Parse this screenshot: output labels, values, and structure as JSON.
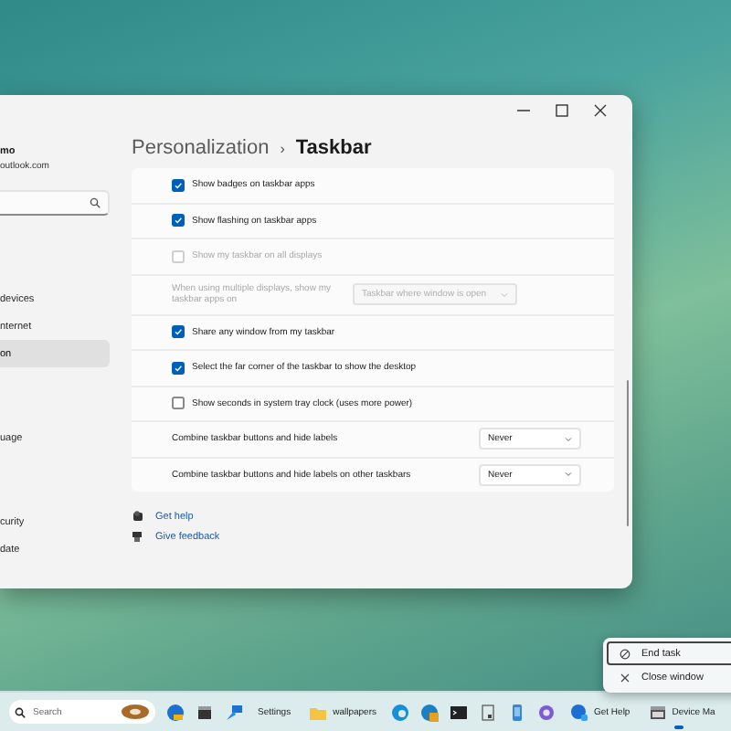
{
  "window": {
    "user": {
      "name": "mo",
      "email": "outlook.com"
    },
    "sidebar": {
      "items": [
        {
          "label": "devices",
          "selected": false
        },
        {
          "label": "nternet",
          "selected": false
        },
        {
          "label": "on",
          "selected": true
        },
        {
          "label": "uage",
          "selected": false
        },
        {
          "label": "curity",
          "selected": false
        },
        {
          "label": "date",
          "selected": false
        }
      ]
    },
    "breadcrumb": {
      "parent": "Personalization",
      "separator": "›",
      "current": "Taskbar"
    },
    "settings": [
      {
        "kind": "checkbox",
        "label": "Show badges on taskbar apps",
        "checked": true,
        "disabled": false
      },
      {
        "kind": "checkbox",
        "label": "Show flashing on taskbar apps",
        "checked": true,
        "disabled": false
      },
      {
        "kind": "checkbox",
        "label": "Show my taskbar on all displays",
        "checked": false,
        "disabled": true
      },
      {
        "kind": "select",
        "label": "When using multiple displays, show my taskbar apps on",
        "value": "Taskbar where window is open",
        "disabled": true
      },
      {
        "kind": "checkbox",
        "label": "Share any window from my taskbar",
        "checked": true,
        "disabled": false
      },
      {
        "kind": "checkbox",
        "label": "Select the far corner of the taskbar to show the desktop",
        "checked": true,
        "disabled": false
      },
      {
        "kind": "checkbox",
        "label": "Show seconds in system tray clock (uses more power)",
        "checked": false,
        "disabled": false
      },
      {
        "kind": "select",
        "label": "Combine taskbar buttons and hide labels",
        "value": "Never",
        "disabled": false
      },
      {
        "kind": "select",
        "label": "Combine taskbar buttons and hide labels on other taskbars",
        "value": "Never",
        "disabled": false
      }
    ],
    "links": [
      {
        "label": "Get help"
      },
      {
        "label": "Give feedback"
      }
    ]
  },
  "taskbar": {
    "search": {
      "placeholder": "Search"
    },
    "apps": [
      {
        "label": "Settings",
        "active": false
      },
      {
        "label": "wallpapers",
        "active": false
      },
      {
        "label": "Get Help",
        "active": false
      },
      {
        "label": "Device Ma",
        "active": true
      }
    ]
  },
  "context_menu": {
    "items": [
      {
        "label": "End task",
        "focused": true
      },
      {
        "label": "Close window",
        "focused": false
      }
    ]
  }
}
